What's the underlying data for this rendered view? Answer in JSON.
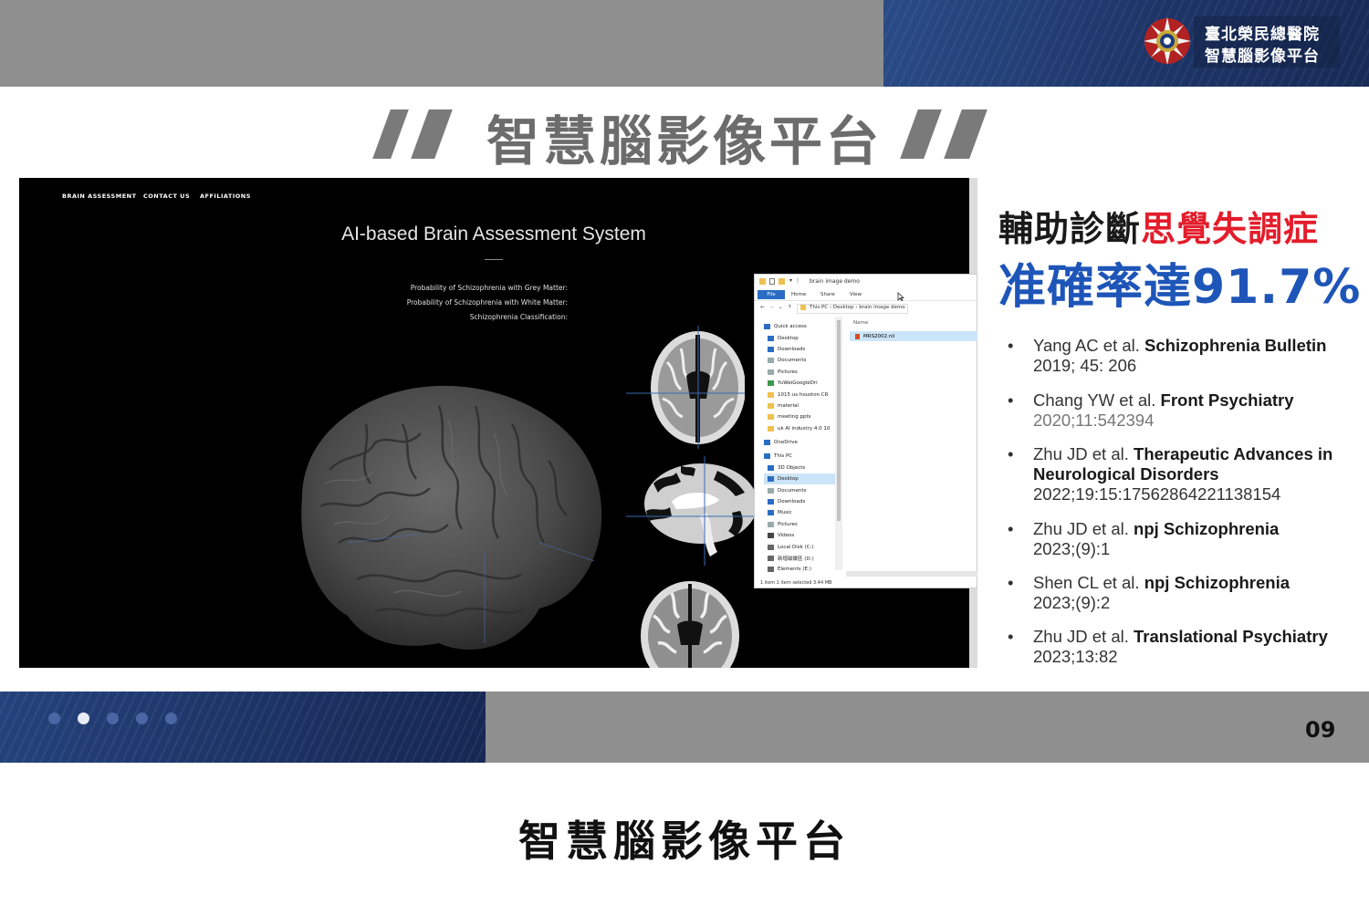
{
  "header": {
    "logo_line1": "臺北榮民總醫院",
    "logo_line2": "智慧腦影像平台",
    "accent_blue": "#1d3568",
    "band_gray": "#8f8f8f"
  },
  "slide_title": "智慧腦影像平台",
  "app": {
    "nav": [
      "BRAIN ASSESSMENT",
      "CONTACT US",
      "AFFILIATIONS"
    ],
    "title": "AI-based Brain Assessment System",
    "probabilities": [
      "Probability of Schizophrenia with Grey Matter:",
      "Probability of Schizophrenia with White Matter:",
      "Schizophrenia Classification:"
    ]
  },
  "explorer": {
    "title": "brain image demo",
    "ribbon": [
      "File",
      "Home",
      "Share",
      "View"
    ],
    "address": "This PC  ›  Desktop  ›  brain image demo",
    "column_name": "Name",
    "file": "MRS2002.nii",
    "nav_items": [
      {
        "label": "Quick access",
        "icon": "star-icon",
        "color": "#2b6cc4"
      },
      {
        "label": "Desktop",
        "icon": "desktop-icon",
        "color": "#2b6cc4"
      },
      {
        "label": "Downloads",
        "icon": "download-icon",
        "color": "#2b6cc4"
      },
      {
        "label": "Documents",
        "icon": "document-icon",
        "color": "#9aa"
      },
      {
        "label": "Pictures",
        "icon": "picture-icon",
        "color": "#9aa"
      },
      {
        "label": "YuWeiGoogleDri",
        "icon": "drive-icon",
        "color": "#3a9a4a"
      },
      {
        "label": "1015 us houston CR",
        "icon": "folder-icon",
        "color": "#f0c050"
      },
      {
        "label": "material",
        "icon": "folder-icon",
        "color": "#f0c050"
      },
      {
        "label": "meeting ppts",
        "icon": "folder-icon",
        "color": "#f0c050"
      },
      {
        "label": "uk AI industry 4.0 10",
        "icon": "folder-icon",
        "color": "#f0c050"
      },
      {
        "label": "OneDrive",
        "icon": "cloud-icon",
        "color": "#2b6cc4"
      },
      {
        "label": "This PC",
        "icon": "pc-icon",
        "color": "#2b6cc4"
      },
      {
        "label": "3D Objects",
        "icon": "cube-icon",
        "color": "#2b6cc4"
      },
      {
        "label": "Desktop",
        "icon": "desktop-icon",
        "color": "#2b6cc4"
      },
      {
        "label": "Documents",
        "icon": "document-icon",
        "color": "#9aa"
      },
      {
        "label": "Downloads",
        "icon": "download-icon",
        "color": "#2b6cc4"
      },
      {
        "label": "Music",
        "icon": "music-icon",
        "color": "#2b6cc4"
      },
      {
        "label": "Pictures",
        "icon": "picture-icon",
        "color": "#9aa"
      },
      {
        "label": "Videos",
        "icon": "video-icon",
        "color": "#444"
      },
      {
        "label": "Local Disk (C:)",
        "icon": "disk-icon",
        "color": "#666"
      },
      {
        "label": "新增磁碟區 (D:)",
        "icon": "disk-icon",
        "color": "#666"
      },
      {
        "label": "Elements (E:)",
        "icon": "disk-icon",
        "color": "#666"
      }
    ],
    "selected_nav_index": 13,
    "status": "1 item     1 item selected  3.44 MB"
  },
  "headline": {
    "part1": "輔助診斷",
    "part2": "思覺失調症",
    "line2": "准確率達91.7%",
    "red": "#e31d2b",
    "blue": "#1e55b8"
  },
  "references": [
    {
      "authors": "Yang AC et al. ",
      "journal": "Schizophrenia Bulletin",
      "cite": "2019; 45: 206",
      "gray": false
    },
    {
      "authors": "Chang YW et al. ",
      "journal": "Front Psychiatry",
      "cite": "2020;11:542394",
      "gray": true
    },
    {
      "authors": "Zhu JD et al. ",
      "journal": "Therapeutic Advances in Neurological Disorders",
      "cite": "2022;19:15:17562864221138154",
      "gray": false
    },
    {
      "authors": "Zhu JD et al. ",
      "journal": "npj Schizophrenia",
      "cite": "2023;(9):1",
      "gray": false
    },
    {
      "authors": "Shen CL et al. ",
      "journal": "npj Schizophrenia",
      "cite": "2023;(9):2",
      "gray": false
    },
    {
      "authors": "Zhu JD et al. ",
      "journal": "Translational Psychiatry",
      "cite": "2023;13:82",
      "gray": false
    }
  ],
  "footer": {
    "page": "09",
    "dots": 5,
    "active_dot": 1
  },
  "caption": "智慧腦影像平台"
}
